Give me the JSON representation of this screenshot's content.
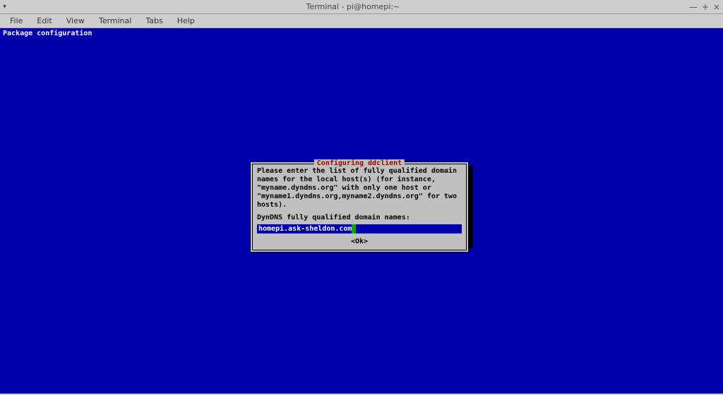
{
  "window": {
    "title": "Terminal - pi@homepi:~"
  },
  "menubar": {
    "items": [
      "File",
      "Edit",
      "View",
      "Terminal",
      "Tabs",
      "Help"
    ]
  },
  "terminal": {
    "header": "Package configuration"
  },
  "dialog": {
    "title": "Configuring ddclient",
    "body": "Please enter the list of fully qualified domain names for the local host(s) (for instance, \"myname.dyndns.org\" with only one host or \"myname1.dyndns.org,myname2.dyndns.org\" for two hosts).",
    "label": "DynDNS fully qualified domain names:",
    "input_value": "homepi.ask-sheldon.com",
    "ok_label": "<Ok>"
  }
}
